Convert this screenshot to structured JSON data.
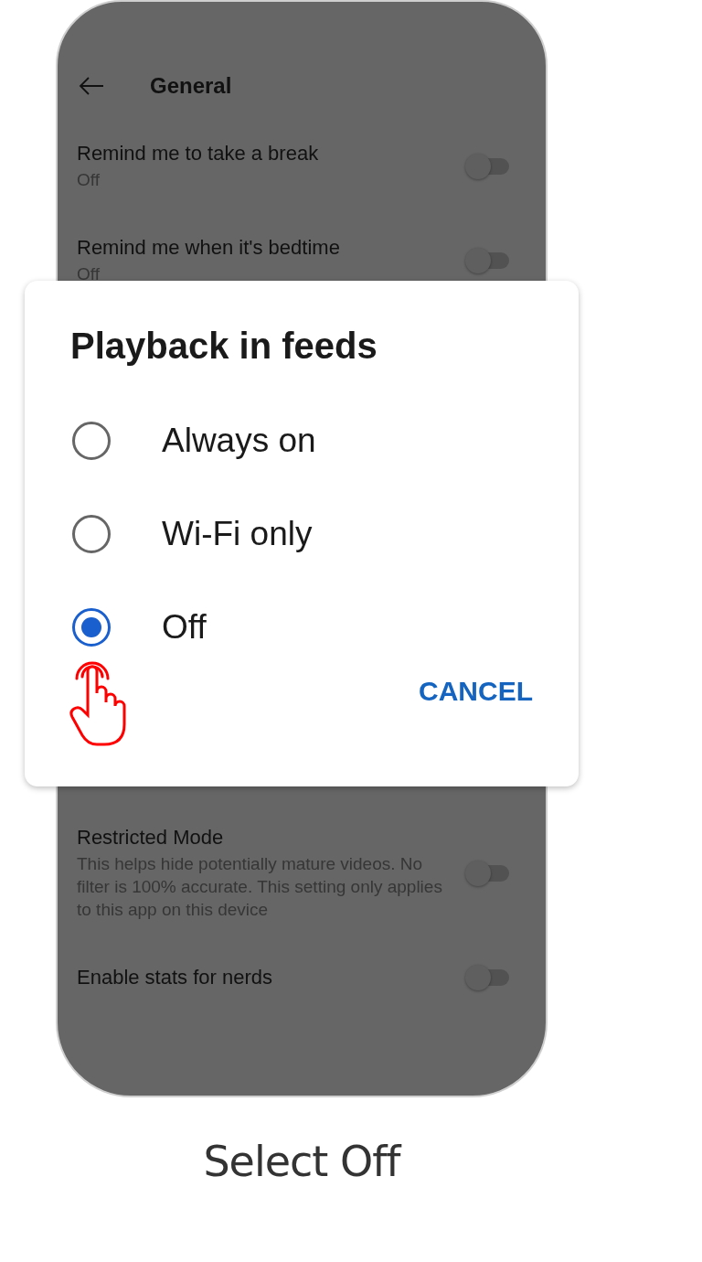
{
  "screen": {
    "title": "General",
    "settings_above": [
      {
        "label": "Remind me to take a break",
        "description": "Off",
        "on": false
      },
      {
        "label": "Remind me when it's bedtime",
        "description": "Off",
        "on": false
      }
    ],
    "settings_below": [
      {
        "label": "Restricted Mode",
        "description": "This helps hide potentially mature videos. No filter is 100% accurate. This setting only applies to this app on this device",
        "on": false
      },
      {
        "label": "Enable stats for nerds",
        "on": false
      }
    ]
  },
  "dialog": {
    "title": "Playback in feeds",
    "options": [
      {
        "label": "Always on",
        "selected": false
      },
      {
        "label": "Wi-Fi only",
        "selected": false
      },
      {
        "label": "Off",
        "selected": true
      }
    ],
    "buttons": [
      "CANCEL"
    ]
  },
  "caption": "Select Off"
}
